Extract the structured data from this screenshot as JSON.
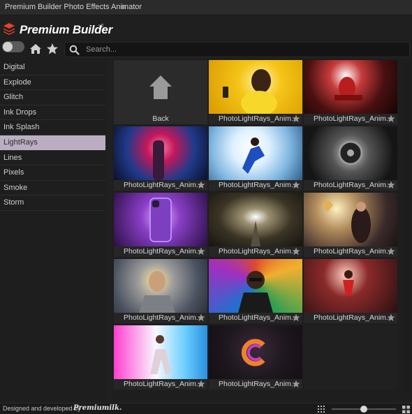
{
  "window": {
    "title": "Premium Builder Photo Effects Animator"
  },
  "brand": {
    "name": "Premium Builder",
    "version": "v2"
  },
  "search": {
    "placeholder": "Search..."
  },
  "sidebar": {
    "items": [
      {
        "label": "Digital"
      },
      {
        "label": "Explode"
      },
      {
        "label": "Glitch"
      },
      {
        "label": "Ink Drops"
      },
      {
        "label": "Ink Splash"
      },
      {
        "label": "LightRays",
        "active": true
      },
      {
        "label": "Lines"
      },
      {
        "label": "Pixels"
      },
      {
        "label": "Smoke"
      },
      {
        "label": "Storm"
      }
    ]
  },
  "grid": {
    "back_label": "Back",
    "items": [
      {
        "label": "PhotoLightRays_Anim..."
      },
      {
        "label": "PhotoLightRays_Anim..."
      },
      {
        "label": "PhotoLightRays_Anim..."
      },
      {
        "label": "PhotoLightRays_Anim..."
      },
      {
        "label": "PhotoLightRays_Anim..."
      },
      {
        "label": "PhotoLightRays_Anim..."
      },
      {
        "label": "PhotoLightRays_Anim..."
      },
      {
        "label": "PhotoLightRays_Anim..."
      },
      {
        "label": "PhotoLightRays_Anim..."
      },
      {
        "label": "PhotoLightRays_Anim..."
      },
      {
        "label": "PhotoLightRays_Anim..."
      },
      {
        "label": "PhotoLightRays_Anim..."
      },
      {
        "label": "PhotoLightRays_Anim..."
      }
    ]
  },
  "footer": {
    "credit": "Designed and developed by",
    "signature": "Premiumilk."
  },
  "colors": {
    "accent": "#e8412c",
    "active_item": "#bcaec2"
  }
}
